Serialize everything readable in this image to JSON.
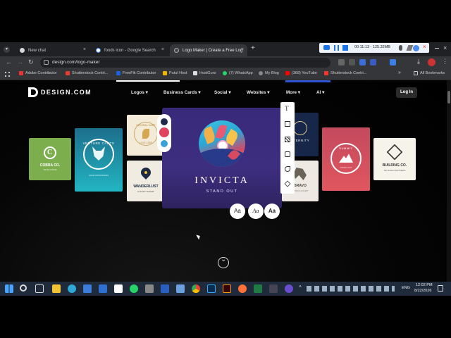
{
  "browser": {
    "tabs": [
      {
        "label": "New chat",
        "close": "×"
      },
      {
        "label": "foods icon - Google Search",
        "close": "×"
      },
      {
        "label": "Logo Maker | Create a Free Log",
        "close": "×"
      }
    ],
    "new_tab": "+",
    "url": "design.com/logo-maker",
    "bookmarks": [
      "Adobe Contributor",
      "Shutterstock Contri...",
      "FreeFik Contributor",
      "Putul Host",
      "HostGuro",
      "(7) WhatsApp",
      "My Blog",
      "(368) YouTube",
      "Shutterstock Contri..."
    ],
    "all_bookmarks": "All Bookmarks",
    "recorder_time": "00:11:13 - 125.32MB"
  },
  "site": {
    "brand": "DESIGN.COM",
    "nav": [
      {
        "label": "Logos",
        "arrow": "▾"
      },
      {
        "label": "Business Cards",
        "arrow": "▾"
      },
      {
        "label": "Social",
        "arrow": "▾"
      },
      {
        "label": "Websites",
        "arrow": "▾"
      },
      {
        "label": "More",
        "arrow": "▾"
      },
      {
        "label": "AI",
        "arrow": "▾"
      }
    ],
    "login": "Log In",
    "cards": {
      "cobra": {
        "name": "COBRA CO.",
        "tag": "TRUE VISION"
      },
      "venture": {
        "name": "VENTURE CARTS",
        "tag": "FOOD PROVISIONS"
      },
      "nature": {
        "name": "NATURAL CARE",
        "tag": "LOVE CARE"
      },
      "wanderlust": {
        "name": "WANDERLUST",
        "tag": "LUXURY TRAVEL"
      },
      "invicta": {
        "name": "INVICTA",
        "tag": "STAND OUT"
      },
      "eternity": {
        "name": "ETERNITY"
      },
      "bravo": {
        "name": "BRAVO",
        "tag": "BRAVO LUXURY"
      },
      "summit": {
        "name": "SUMMIT",
        "tag": "STAND OUT"
      },
      "building": {
        "name": "BUILDING CO.",
        "tag": "TRUSTED PARTNERS"
      }
    },
    "font_buttons": [
      "Aa",
      "Aa",
      "Aa"
    ],
    "palette": [
      "#1e2a4a",
      "#e0445e",
      "#3aa0d8"
    ],
    "tool_icons": [
      "text-icon",
      "layout-icon",
      "texture-icon",
      "frame-icon",
      "shapes-icon",
      "layers-icon"
    ],
    "scroll_down": "⌄"
  },
  "taskbar": {
    "lang": "ENG",
    "time": "12:02 PM",
    "date": "8/22/2026"
  }
}
